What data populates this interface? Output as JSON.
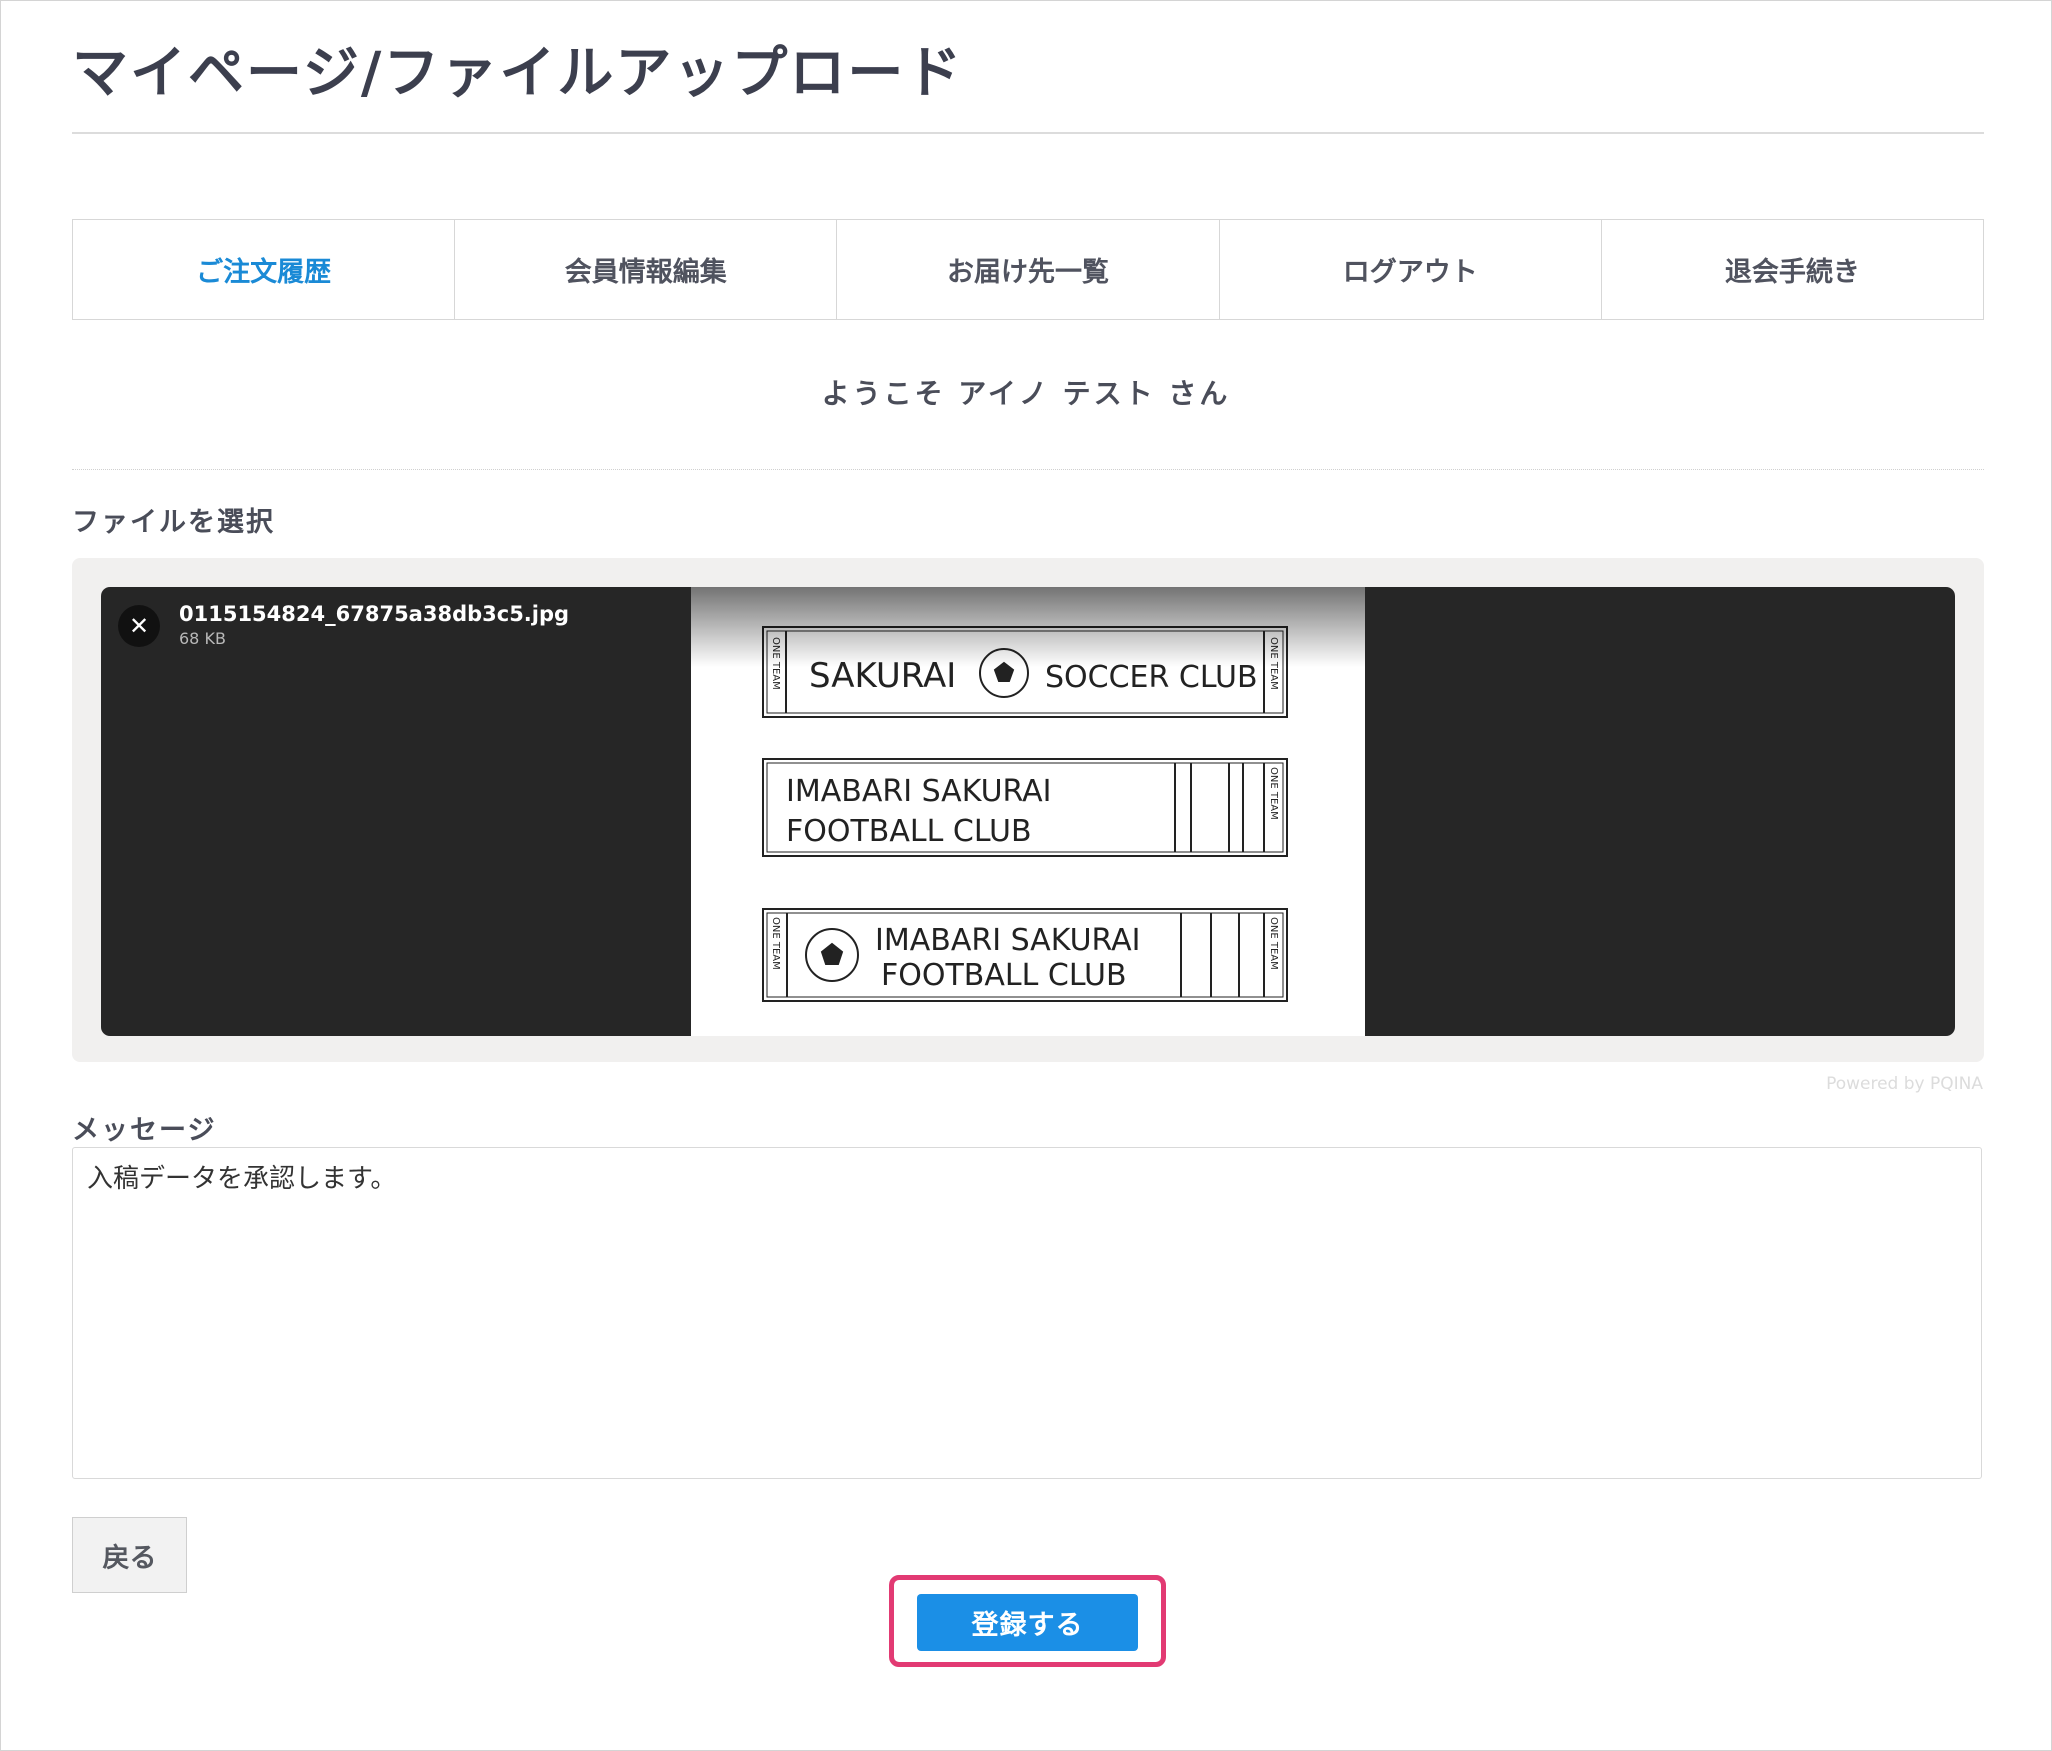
{
  "page": {
    "title": "マイページ/ファイルアップロード"
  },
  "tabs": [
    {
      "label": "ご注文履歴",
      "active": true
    },
    {
      "label": "会員情報編集",
      "active": false
    },
    {
      "label": "お届け先一覧",
      "active": false
    },
    {
      "label": "ログアウト",
      "active": false
    },
    {
      "label": "退会手続き",
      "active": false
    }
  ],
  "welcome": "ようこそ アイノ テスト さん",
  "file_section": {
    "label": "ファイルを選択",
    "file": {
      "remove_icon": "close-icon",
      "remove_glyph": "✕",
      "name": "0115154824_67875a38db3c5.jpg",
      "size": "68 KB"
    },
    "preview_text": {
      "banner1_main": "SAKURAI",
      "banner1_right": "SOCCER CLUB",
      "banner2_line1": "IMABARI SAKURAI",
      "banner2_line2": "FOOTBALL CLUB",
      "banner3_line1": "IMABARI SAKURAI",
      "banner3_line2": "FOOTBALL CLUB",
      "side_text": "ONE TEAM"
    },
    "credit": "Powered by PQINA"
  },
  "message_section": {
    "label": "メッセージ",
    "value": "入稿データを承認します。"
  },
  "buttons": {
    "back": "戻る",
    "submit": "登録する"
  },
  "colors": {
    "accent": "#1b8fe6",
    "active_tab": "#1a8ad6",
    "highlight": "#e23a73"
  }
}
